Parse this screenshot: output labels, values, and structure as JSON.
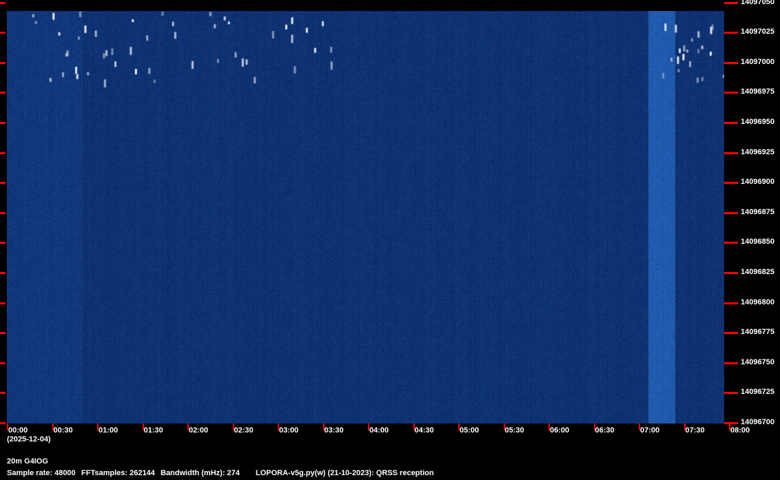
{
  "chart_data": {
    "type": "heatmap",
    "title": "20m G4IOG",
    "date": "(2025-12-04)",
    "x_ticks": [
      "00:00",
      "00:30",
      "01:00",
      "01:30",
      "02:00",
      "02:30",
      "03:00",
      "03:30",
      "04:00",
      "04:30",
      "05:00",
      "05:30",
      "06:00",
      "06:30",
      "07:00",
      "07:30",
      "08:00"
    ],
    "y_ticks": [
      "14097050",
      "14097025",
      "14097000",
      "14096975",
      "14096950",
      "14096925",
      "14096900",
      "14096875",
      "14096850",
      "14096825",
      "14096800",
      "14096775",
      "14096750",
      "14096725",
      "14096700"
    ],
    "xlim_hours": [
      0,
      8
    ],
    "ylim_hz": [
      14096700,
      14097050
    ],
    "bright_band_hours": [
      7.15,
      7.45
    ],
    "colors": {
      "background": "#0a2d6b",
      "signal": "#e8eef5",
      "tick": "#ff0000"
    }
  },
  "footer": {
    "sample_rate": "Sample rate: 48000",
    "fft": "FFTsamples: 262144",
    "bandwidth": "Bandwidth (mHz): 274",
    "program": "LOPORA-v5g.py(w) (21-10-2023): QRSS reception"
  }
}
